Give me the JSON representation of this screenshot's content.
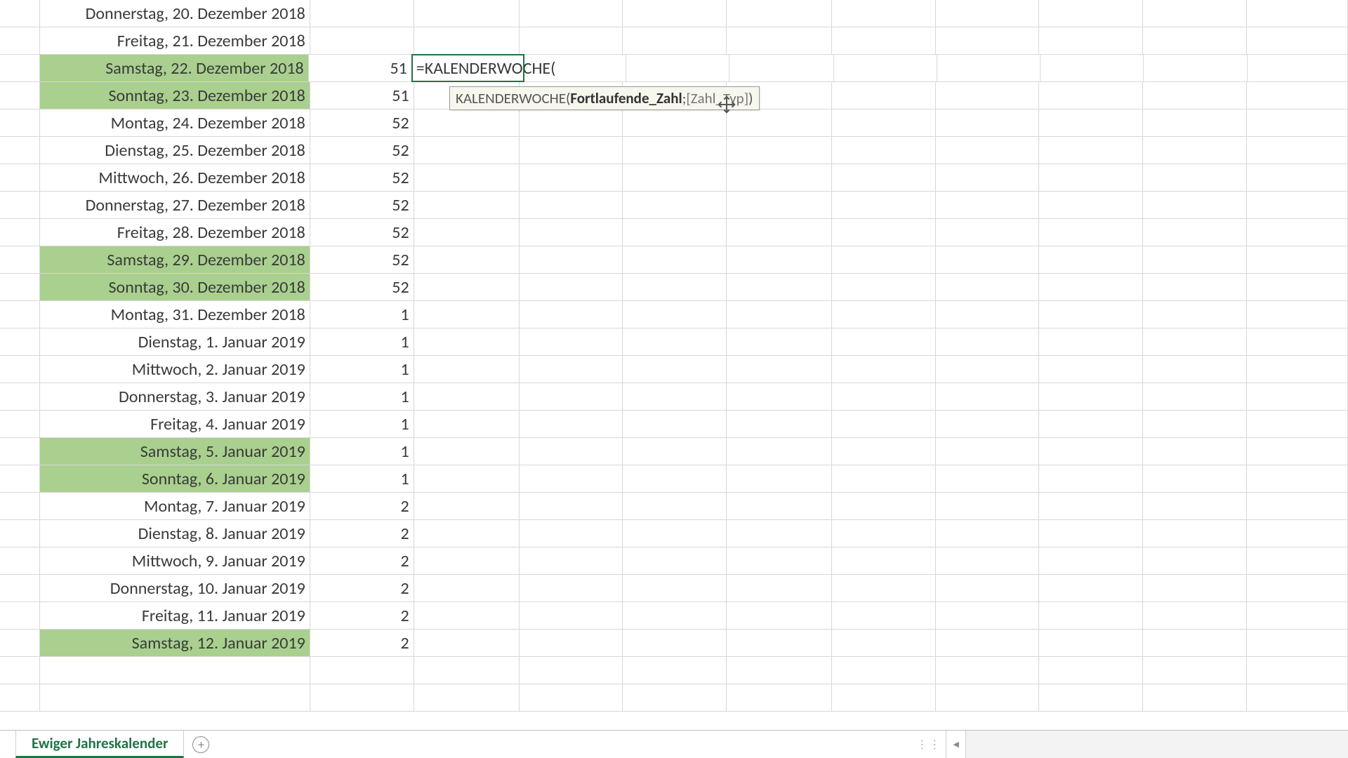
{
  "formula_input": "=KALENDERWOCHE(",
  "tooltip": {
    "func": "KALENDERWOCHE(",
    "arg_bold": "Fortlaufende_Zahl",
    "sep": "; ",
    "arg_opt": "[Zahl_Typ]",
    "close": ")"
  },
  "sheet_tab": "Ewiger Jahreskalender",
  "add_tab_icon": "+",
  "rows": [
    {
      "date": "Donnerstag, 20. Dezember 2018",
      "week": "",
      "weekend": false
    },
    {
      "date": "Freitag, 21. Dezember 2018",
      "week": "",
      "weekend": false
    },
    {
      "date": "Samstag, 22. Dezember 2018",
      "week": "51",
      "weekend": true,
      "edit": true
    },
    {
      "date": "Sonntag, 23. Dezember 2018",
      "week": "51",
      "weekend": true
    },
    {
      "date": "Montag, 24. Dezember 2018",
      "week": "52",
      "weekend": false
    },
    {
      "date": "Dienstag, 25. Dezember 2018",
      "week": "52",
      "weekend": false
    },
    {
      "date": "Mittwoch, 26. Dezember 2018",
      "week": "52",
      "weekend": false
    },
    {
      "date": "Donnerstag, 27. Dezember 2018",
      "week": "52",
      "weekend": false
    },
    {
      "date": "Freitag, 28. Dezember 2018",
      "week": "52",
      "weekend": false
    },
    {
      "date": "Samstag, 29. Dezember 2018",
      "week": "52",
      "weekend": true
    },
    {
      "date": "Sonntag, 30. Dezember 2018",
      "week": "52",
      "weekend": true
    },
    {
      "date": "Montag, 31. Dezember 2018",
      "week": "1",
      "weekend": false
    },
    {
      "date": "Dienstag, 1. Januar 2019",
      "week": "1",
      "weekend": false
    },
    {
      "date": "Mittwoch, 2. Januar 2019",
      "week": "1",
      "weekend": false
    },
    {
      "date": "Donnerstag, 3. Januar 2019",
      "week": "1",
      "weekend": false
    },
    {
      "date": "Freitag, 4. Januar 2019",
      "week": "1",
      "weekend": false
    },
    {
      "date": "Samstag, 5. Januar 2019",
      "week": "1",
      "weekend": true
    },
    {
      "date": "Sonntag, 6. Januar 2019",
      "week": "1",
      "weekend": true
    },
    {
      "date": "Montag, 7. Januar 2019",
      "week": "2",
      "weekend": false
    },
    {
      "date": "Dienstag, 8. Januar 2019",
      "week": "2",
      "weekend": false
    },
    {
      "date": "Mittwoch, 9. Januar 2019",
      "week": "2",
      "weekend": false
    },
    {
      "date": "Donnerstag, 10. Januar 2019",
      "week": "2",
      "weekend": false
    },
    {
      "date": "Freitag, 11. Januar 2019",
      "week": "2",
      "weekend": false
    },
    {
      "date": "Samstag, 12. Januar 2019",
      "week": "2",
      "weekend": true
    },
    {
      "date": "",
      "week": "",
      "weekend": false
    },
    {
      "date": "",
      "week": "",
      "weekend": false
    }
  ]
}
